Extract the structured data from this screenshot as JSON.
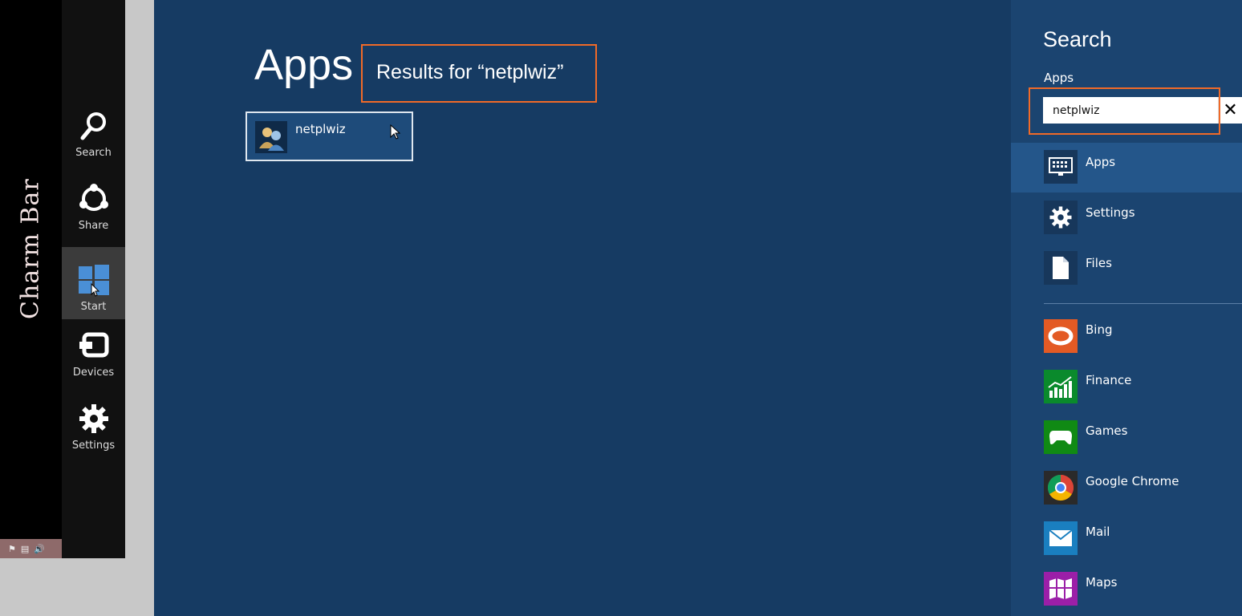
{
  "overlay": {
    "charm_bar_label": "Charm Bar"
  },
  "charms": [
    {
      "label": "Search",
      "icon": "search-icon"
    },
    {
      "label": "Share",
      "icon": "share-icon"
    },
    {
      "label": "Start",
      "icon": "windows-logo-icon",
      "active": true
    },
    {
      "label": "Devices",
      "icon": "devices-icon"
    },
    {
      "label": "Settings",
      "icon": "gear-icon"
    }
  ],
  "main": {
    "heading": "Apps",
    "results_text": "Results for “netplwiz”",
    "results": [
      {
        "label": "netplwiz",
        "icon": "user-accounts-icon"
      }
    ]
  },
  "search_pane": {
    "title": "Search",
    "scope": "Apps",
    "query": "netplwiz",
    "clear_icon": "close-icon",
    "categories": [
      {
        "label": "Apps",
        "icon": "keyboard-icon",
        "selected": true
      },
      {
        "label": "Settings",
        "icon": "gear-icon"
      },
      {
        "label": "Files",
        "icon": "file-icon"
      }
    ],
    "apps": [
      {
        "label": "Bing",
        "icon": "bing-icon",
        "color": "#e35a24"
      },
      {
        "label": "Finance",
        "icon": "finance-icon",
        "color": "#0a8a2c"
      },
      {
        "label": "Games",
        "icon": "games-icon",
        "color": "#108a14"
      },
      {
        "label": "Google Chrome",
        "icon": "chrome-icon",
        "color": "#2a2a2a"
      },
      {
        "label": "Mail",
        "icon": "mail-icon",
        "color": "#1a7fc0"
      },
      {
        "label": "Maps",
        "icon": "maps-icon",
        "color": "#9b1fa8"
      }
    ]
  },
  "colors": {
    "start_background": "#163b63",
    "search_pane": "#1b4470",
    "highlight": "#f06a28",
    "charm_bar": "#111111"
  }
}
